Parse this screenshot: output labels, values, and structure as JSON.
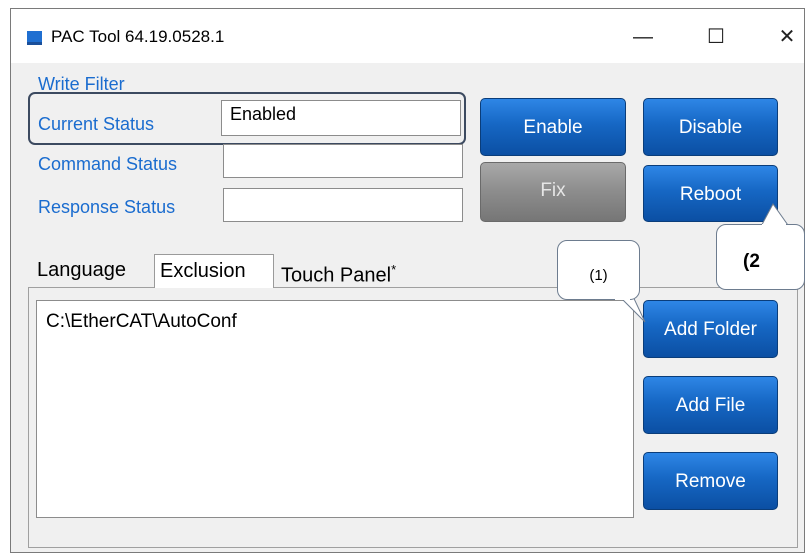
{
  "window": {
    "title": "PAC Tool 64.19.0528.1",
    "controls": {
      "minimize": "—",
      "maximize": "☐",
      "close": "✕"
    }
  },
  "write_filter": {
    "group_label": "Write Filter",
    "current_status_label": "Current Status",
    "current_status_value": "Enabled",
    "command_status_label": "Command Status",
    "command_status_value": "",
    "response_status_label": "Response Status",
    "response_status_value": ""
  },
  "buttons": {
    "enable": "Enable",
    "disable": "Disable",
    "fix": "Fix",
    "reboot": "Reboot",
    "add_folder": "Add Folder",
    "add_file": "Add File",
    "remove": "Remove"
  },
  "tabs": [
    {
      "label": "Language"
    },
    {
      "label": "Exclusion",
      "active": true
    },
    {
      "label": "Touch Panel",
      "marker": "*"
    }
  ],
  "exclusion_list": [
    "C:\\EtherCAT\\AutoConf"
  ],
  "annotations": {
    "callout_1": "(1)",
    "callout_2": "(2"
  },
  "colors": {
    "button_blue": "#1667c4",
    "label_blue": "#1a6ccf",
    "disabled_gray": "#8c8c8c"
  }
}
